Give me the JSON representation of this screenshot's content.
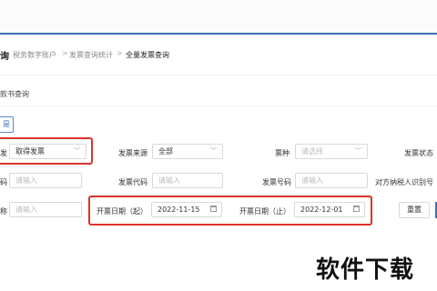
{
  "breadcrumb": {
    "cut_title": "询",
    "items": [
      "税务数字账户",
      "发票查询统计",
      "全量发票查询"
    ],
    "separator": ">"
  },
  "subtitle": "款书查询",
  "tab_chip": "是",
  "row1": {
    "label_cut": "发",
    "select1_value": "取得发票",
    "source_label": "发票来源",
    "source_value": "全部",
    "kind_label": "票种",
    "kind_placeholder": "请选择",
    "status_label": "发票状态"
  },
  "row2": {
    "label_cut": "码",
    "input1_placeholder": "请输入",
    "code_label": "发票代码",
    "code_placeholder": "请输入",
    "number_label": "发票号码",
    "number_placeholder": "请输入",
    "taxid_label": "对方纳税人识别号"
  },
  "row3": {
    "label_cut": "称",
    "input1_placeholder": "请输入",
    "start_label": "开票日期（起）",
    "start_value": "2022-11-15",
    "end_label": "开票日期（止）",
    "end_value": "2022-12-01",
    "reset_label": "重置"
  },
  "watermark": "软件下载",
  "colors": {
    "highlight_border": "#d9342b",
    "accent": "#3d6fb5"
  }
}
